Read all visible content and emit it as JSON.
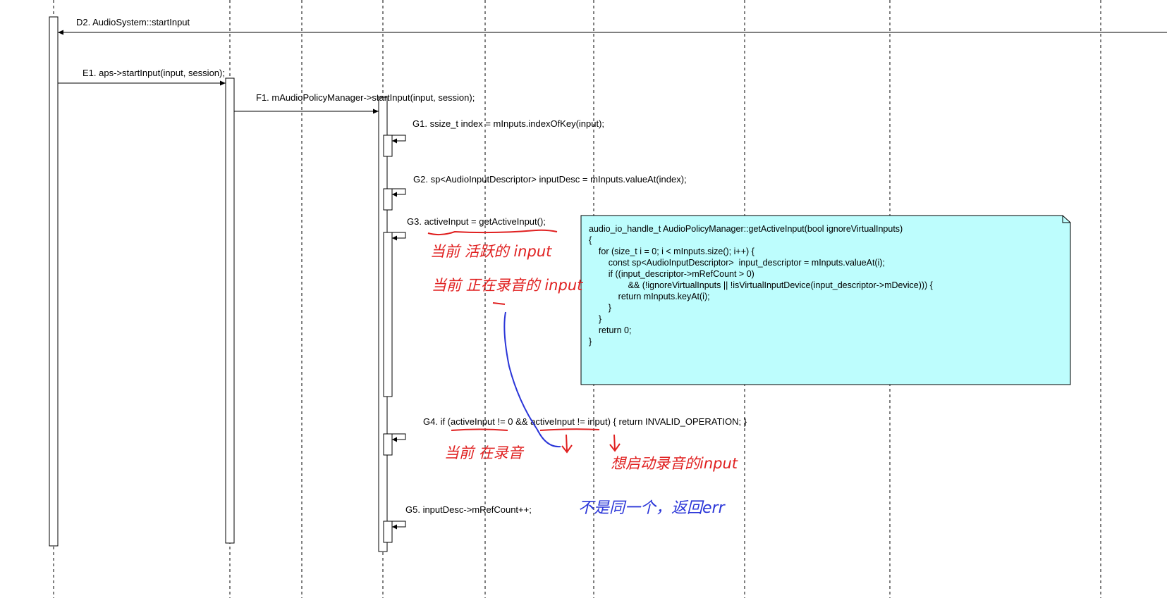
{
  "colors": {
    "note_fill": "#bdfdfd",
    "hand_red": "#e02020",
    "hand_blue": "#2a35d8"
  },
  "messages": {
    "d2": "D2. AudioSystem::startInput",
    "e1": "E1. aps->startInput(input, session);",
    "f1": "F1. mAudioPolicyManager->startInput(input, session);",
    "g1": "G1. ssize_t index = mInputs.indexOfKey(input);",
    "g2": "G2. sp<AudioInputDescriptor> inputDesc = mInputs.valueAt(index);",
    "g3": "G3. activeInput = getActiveInput();",
    "g4": "G4. if (activeInput != 0 && activeInput != input) { return INVALID_OPERATION; }",
    "g5": "G5. inputDesc->mRefCount++;"
  },
  "note": {
    "lines": [
      "audio_io_handle_t AudioPolicyManager::getActiveInput(bool ignoreVirtualInputs)",
      "{",
      "    for (size_t i = 0; i < mInputs.size(); i++) {",
      "        const sp<AudioInputDescriptor>  input_descriptor = mInputs.valueAt(i);",
      "        if ((input_descriptor->mRefCount > 0)",
      "                && (!ignoreVirtualInputs || !isVirtualInputDevice(input_descriptor->mDevice))) {",
      "            return mInputs.keyAt(i);",
      "        }",
      "    }",
      "    return 0;",
      "}"
    ]
  },
  "handwriting": {
    "active_input": "当前 活跃的 input",
    "recording_input": "当前 正在录音的 input",
    "currently_recording": "当前 在录音",
    "want_to_start": "想启动录音的input",
    "not_same_err": "不是同一个，返回err"
  }
}
